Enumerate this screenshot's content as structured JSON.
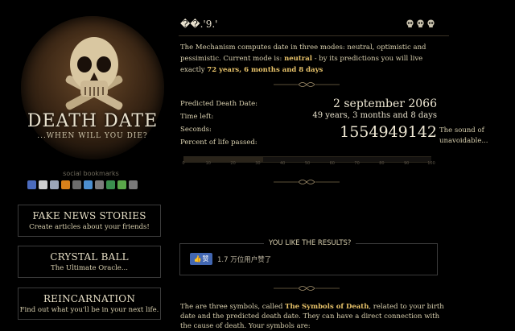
{
  "logo": {
    "title": "DEATH DATE",
    "subtitle": "...WHEN WILL YOU DIE?"
  },
  "social": {
    "label": "social bookmarks",
    "icons": [
      "delicious-icon",
      "digg-icon",
      "stumbleupon-icon",
      "reddit-icon",
      "technorati-icon",
      "newsvine-icon",
      "furl-icon",
      "blinklist-icon",
      "magnolia-icon",
      "yahoo-icon"
    ],
    "colors": [
      "#4b6bbd",
      "#cfcfcf",
      "#9ca6b8",
      "#d9811a",
      "#6d6d6d",
      "#4c8fd0",
      "#7d7d7d",
      "#3a8f4d",
      "#5aa84a",
      "#7a7a7a"
    ]
  },
  "promos": [
    {
      "title": "FAKE NEWS STORIES",
      "subtitle": "Create articles about your friends!"
    },
    {
      "title": "CRYSTAL BALL",
      "subtitle": "The Ultimate Oracle..."
    },
    {
      "title": "REINCARNATION",
      "subtitle": "Find out what you'll be in your next life."
    }
  ],
  "main": {
    "heading": "��.'9.'",
    "intro": {
      "part1": "The Mechanism computes date in three modes: neutral, optimistic and pessimistic. Current mode is: ",
      "mode": "neutral",
      "part2": " - by its predictions you will live exactly ",
      "lifespan": "72 years, 6 months and 8 days"
    },
    "results": {
      "death_date_label": "Predicted Death Date:",
      "death_date_value": "2 september 2066",
      "time_left_label": "Time left:",
      "time_left_value": "49 years, 3 months and 8 days",
      "seconds_label": "Seconds:",
      "seconds_value": "1554949142",
      "seconds_caption": "The sound of unavoidable...",
      "percent_label": "Percent of life passed:",
      "percent_passed": 0.32,
      "ticks": [
        "0",
        "10",
        "20",
        "30",
        "40",
        "50",
        "60",
        "70",
        "80",
        "90",
        "100"
      ]
    },
    "like": {
      "title": "YOU LIKE THE RESULTS?",
      "button": "赞",
      "count": "1.7 万位用户赞了"
    },
    "symbols": {
      "part1": "The are three symbols, called ",
      "name": "The Symbols of Death",
      "part2": ", related to your birth date and the predicted death date. They can have a direct connection with the cause of death. Your symbols are:"
    }
  }
}
